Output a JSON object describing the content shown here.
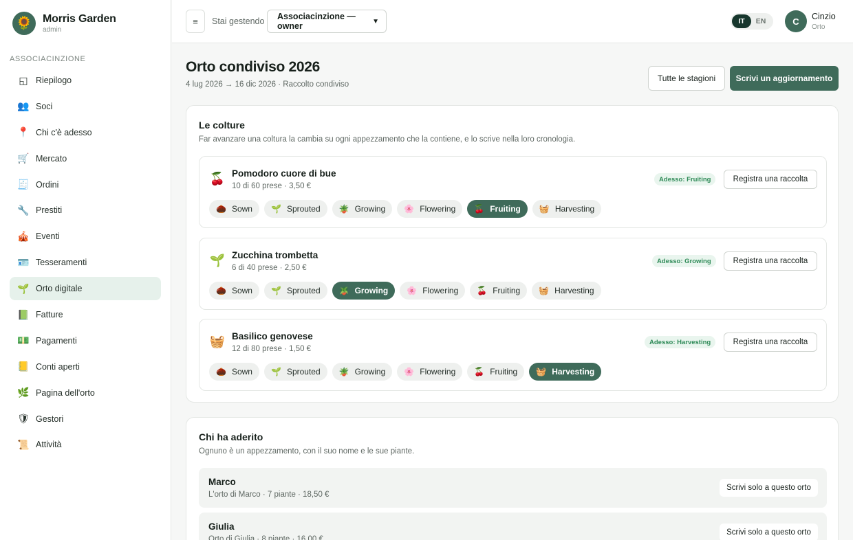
{
  "brand": {
    "name": "Morris Garden",
    "role": "admin",
    "logo": "🌻"
  },
  "sidebar": {
    "section": "ASSOCIACINZIONE",
    "items": [
      {
        "label": "Riepilogo",
        "icon": "◱",
        "name": "riepilogo"
      },
      {
        "label": "Soci",
        "icon": "👥",
        "name": "soci"
      },
      {
        "label": "Chi c'è adesso",
        "icon": "📍",
        "name": "chi-ce-adesso"
      },
      {
        "label": "Mercato",
        "icon": "🛒",
        "name": "mercato"
      },
      {
        "label": "Ordini",
        "icon": "🧾",
        "name": "ordini"
      },
      {
        "label": "Prestiti",
        "icon": "🔧",
        "name": "prestiti"
      },
      {
        "label": "Eventi",
        "icon": "🎪",
        "name": "eventi"
      },
      {
        "label": "Tesseramenti",
        "icon": "🪪",
        "name": "tesseramenti"
      },
      {
        "label": "Orto digitale",
        "icon": "🌱",
        "name": "orto-digitale",
        "active": true
      },
      {
        "label": "Fatture",
        "icon": "📗",
        "name": "fatture"
      },
      {
        "label": "Pagamenti",
        "icon": "💵",
        "name": "pagamenti"
      },
      {
        "label": "Conti aperti",
        "icon": "📒",
        "name": "conti-aperti"
      },
      {
        "label": "Pagina dell'orto",
        "icon": "🌿",
        "name": "pagina-orto"
      },
      {
        "label": "Gestori",
        "icon": "🛡",
        "name": "gestori"
      },
      {
        "label": "Attività",
        "icon": "📜",
        "name": "attivita"
      }
    ]
  },
  "topbar": {
    "menu_icon": "≡",
    "managing_label": "Stai gestendo",
    "select_value": "Associacinzione — owner",
    "lang": {
      "it": "IT",
      "en": "EN",
      "active": "IT"
    },
    "user": {
      "initial": "C",
      "name": "Cinzio",
      "role": "Orto"
    }
  },
  "page": {
    "title": "Orto condiviso 2026",
    "subtitle": "4 lug 2026 → 16 dic 2026 · Raccolto condiviso",
    "all_seasons": "Tutte le stagioni",
    "write_update": "Scrivi un aggiornamento"
  },
  "crops_card": {
    "title": "Le colture",
    "description": "Far avanzare una coltura la cambia su ogni appezzamento che la contiene, e lo scrive nella loro cronologia.",
    "record_label": "Registra una raccolta",
    "stages": [
      {
        "label": "Sown",
        "icon": "🌰"
      },
      {
        "label": "Sprouted",
        "icon": "🌱"
      },
      {
        "label": "Growing",
        "icon": "🪴"
      },
      {
        "label": "Flowering",
        "icon": "🌸"
      },
      {
        "label": "Fruiting",
        "icon": "🍒"
      },
      {
        "label": "Harvesting",
        "icon": "🧺"
      }
    ],
    "crops": [
      {
        "name": "Pomodoro cuore di bue",
        "meta": "10 di 60 prese · 3,50 €",
        "badge": "Adesso: Fruiting",
        "icon": "🍒",
        "current": 4
      },
      {
        "name": "Zucchina trombetta",
        "meta": "6 di 40 prese · 2,50 €",
        "badge": "Adesso: Growing",
        "icon": "🌱",
        "current": 2
      },
      {
        "name": "Basilico genovese",
        "meta": "12 di 80 prese · 1,50 €",
        "badge": "Adesso: Harvesting",
        "icon": "🧺",
        "current": 5
      }
    ]
  },
  "members_card": {
    "title": "Chi ha aderito",
    "description": "Ognuno è un appezzamento, con il suo nome e le sue piante.",
    "write_only_label": "Scrivi solo a questo orto",
    "members": [
      {
        "name": "Marco",
        "meta": "L'orto di Marco · 7 piante · 18,50 €"
      },
      {
        "name": "Giulia",
        "meta": "Orto di Giulia · 8 piante · 16,00 €"
      }
    ]
  },
  "colors": {
    "accent": "#3f6b5a",
    "badge_text": "#2e8a57",
    "badge_bg": "#e9f5ee",
    "active_nav": "#e6f1eb"
  }
}
